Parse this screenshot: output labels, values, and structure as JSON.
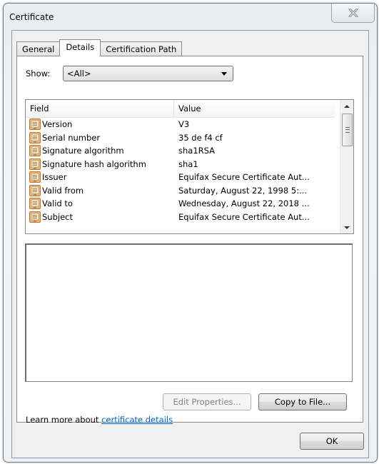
{
  "window": {
    "title": "Certificate",
    "close_icon": "close-x-icon"
  },
  "tabs": [
    {
      "label": "General",
      "active": false
    },
    {
      "label": "Details",
      "active": true
    },
    {
      "label": "Certification Path",
      "active": false
    }
  ],
  "show": {
    "label": "Show:",
    "selected": "<All>"
  },
  "list": {
    "columns": {
      "field": "Field",
      "value": "Value"
    },
    "row_icon": "certificate-field-icon",
    "rows": [
      {
        "field": "Version",
        "value": "V3"
      },
      {
        "field": "Serial number",
        "value": "35 de f4 cf"
      },
      {
        "field": "Signature algorithm",
        "value": "sha1RSA"
      },
      {
        "field": "Signature hash algorithm",
        "value": "sha1"
      },
      {
        "field": "Issuer",
        "value": "Equifax Secure Certificate Aut..."
      },
      {
        "field": "Valid from",
        "value": "Saturday, August 22, 1998 5:..."
      },
      {
        "field": "Valid to",
        "value": "Wednesday, August 22, 2018 ..."
      },
      {
        "field": "Subject",
        "value": "Equifax Secure Certificate Aut..."
      }
    ]
  },
  "detail_text": "",
  "buttons": {
    "edit_properties": "Edit Properties...",
    "copy_to_file": "Copy to File...",
    "ok": "OK"
  },
  "learn_more": {
    "prefix": "Learn more about ",
    "link": "certificate details"
  },
  "colors": {
    "link": "#0066cc",
    "icon_fill": "#e8b57a",
    "icon_border": "#b87a3c"
  }
}
